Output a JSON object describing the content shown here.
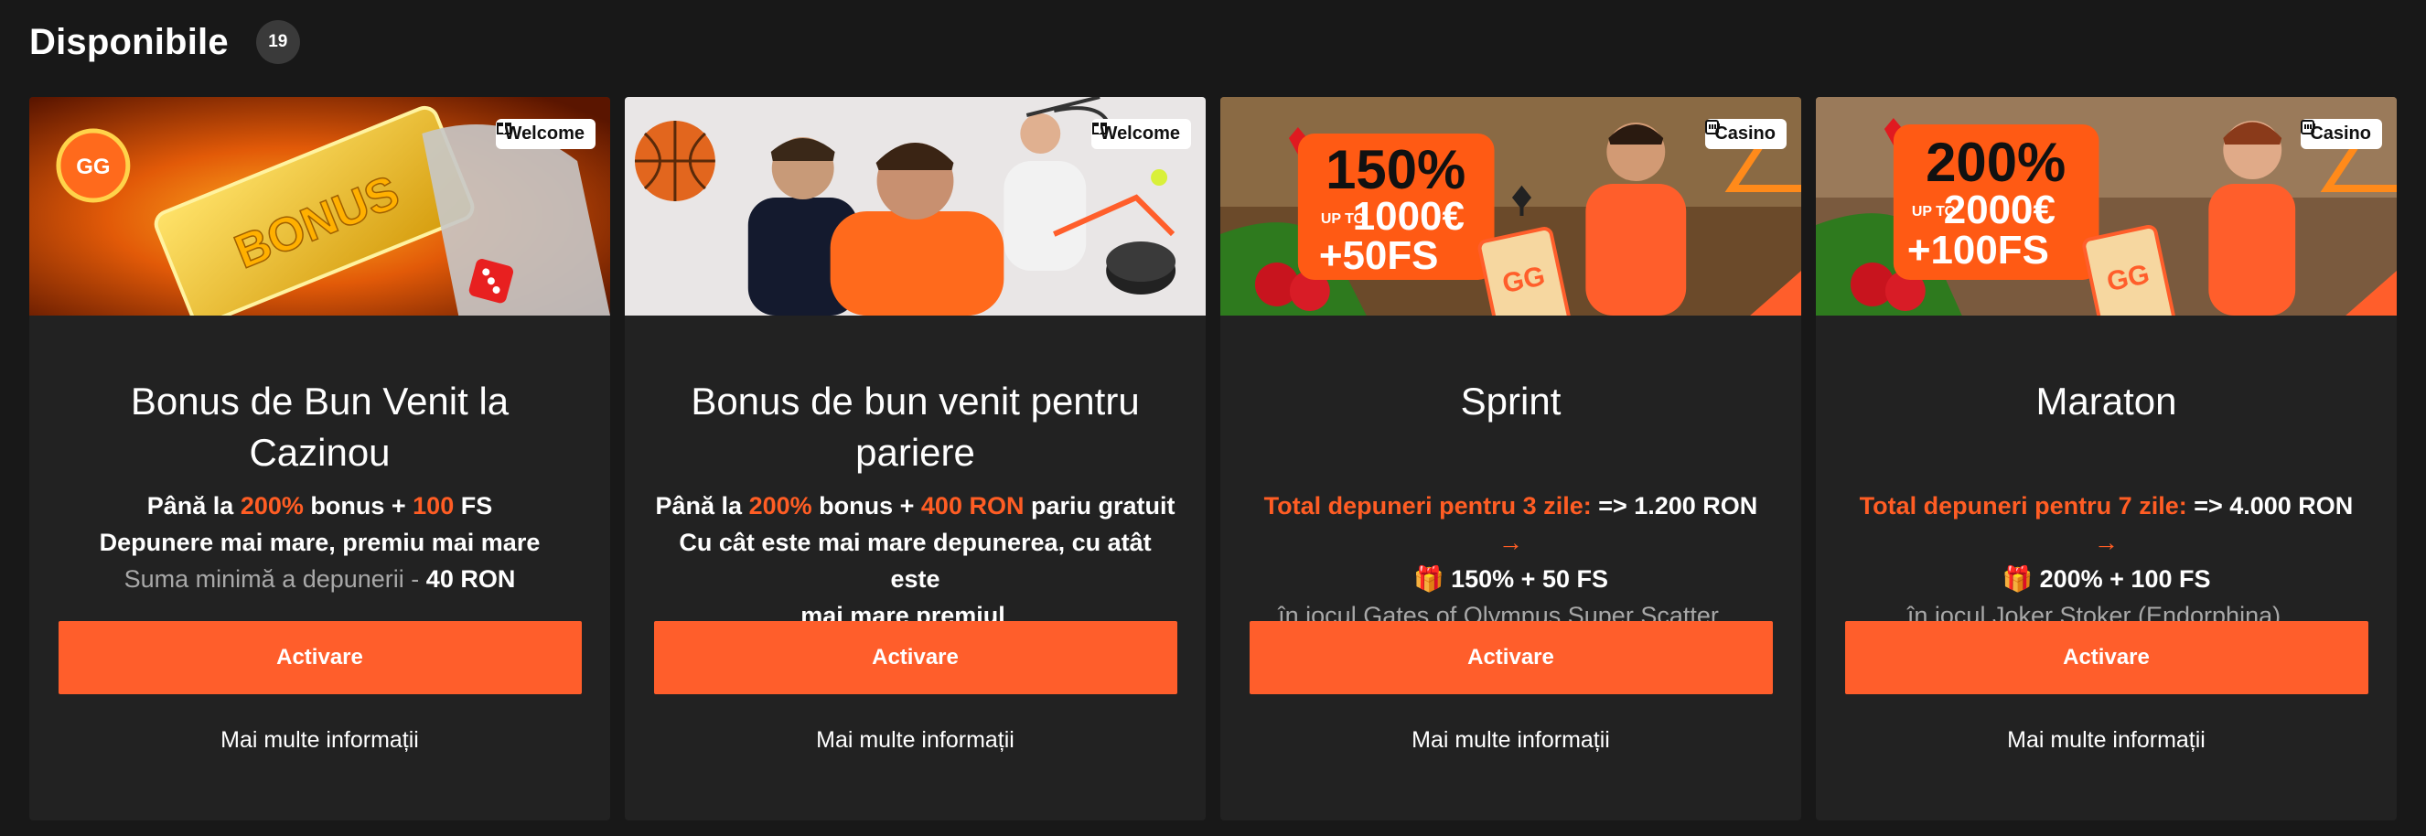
{
  "header": {
    "title": "Disponibile",
    "count": "19"
  },
  "cards": [
    {
      "tag": "Welcome",
      "tag_icon": "gift-icon",
      "title": "Bonus de Bun Venit la Cazinou",
      "line1": {
        "p1": "Până la ",
        "p2": "200%",
        "p3": " bonus + ",
        "p4": "100",
        "p5": " FS"
      },
      "line2": "Depunere mai mare, premiu mai mare",
      "line3": {
        "p1": "Suma minimă a depunerii - ",
        "p2": "40 RON"
      },
      "button": "Activare",
      "more": "Mai multe informații"
    },
    {
      "tag": "Welcome",
      "tag_icon": "gift-icon",
      "title": "Bonus de bun venit pentru pariere",
      "line1": {
        "p1": "Până la ",
        "p2": "200%",
        "p3": " bonus + ",
        "p4": "400 RON",
        "p5": " pariu gratuit"
      },
      "line2": "Cu cât este mai mare depunerea, cu atât este",
      "line3": {
        "p1": "mai mare premiul",
        "p2": "…"
      },
      "button": "Activare",
      "more": "Mai multe informații"
    },
    {
      "tag": "Casino",
      "tag_icon": "slot-machine-icon",
      "banner_text": {
        "percent": "150%",
        "upto": "UP TO",
        "amount": "1000€",
        "fs": "+50FS"
      },
      "title": "Sprint",
      "line1": {
        "p1": "Total depuneri pentru 3 zile:",
        "p2": " => 1.200 RON ",
        "p3": "→"
      },
      "line2": {
        "icon": "🎁",
        "text": " 150% + 50 FS"
      },
      "line3": "în jocul Gates of Olympus Super Scatter…",
      "button": "Activare",
      "more": "Mai multe informații"
    },
    {
      "tag": "Casino",
      "tag_icon": "slot-machine-icon",
      "banner_text": {
        "percent": "200%",
        "upto": "UP TO",
        "amount": "2000€",
        "fs": "+100FS"
      },
      "title": "Maraton",
      "line1": {
        "p1": "Total depuneri pentru 7 zile:",
        "p2": " => 4.000 RON ",
        "p3": "→"
      },
      "line2": {
        "icon": "🎁",
        "text": " 200% + 100 FS"
      },
      "line3": "în jocul Joker Stoker (Endorphina)…",
      "button": "Activare",
      "more": "Mai multe informații"
    }
  ],
  "colors": {
    "accent": "#ff5e2b",
    "background": "#181818",
    "card": "#222222"
  }
}
